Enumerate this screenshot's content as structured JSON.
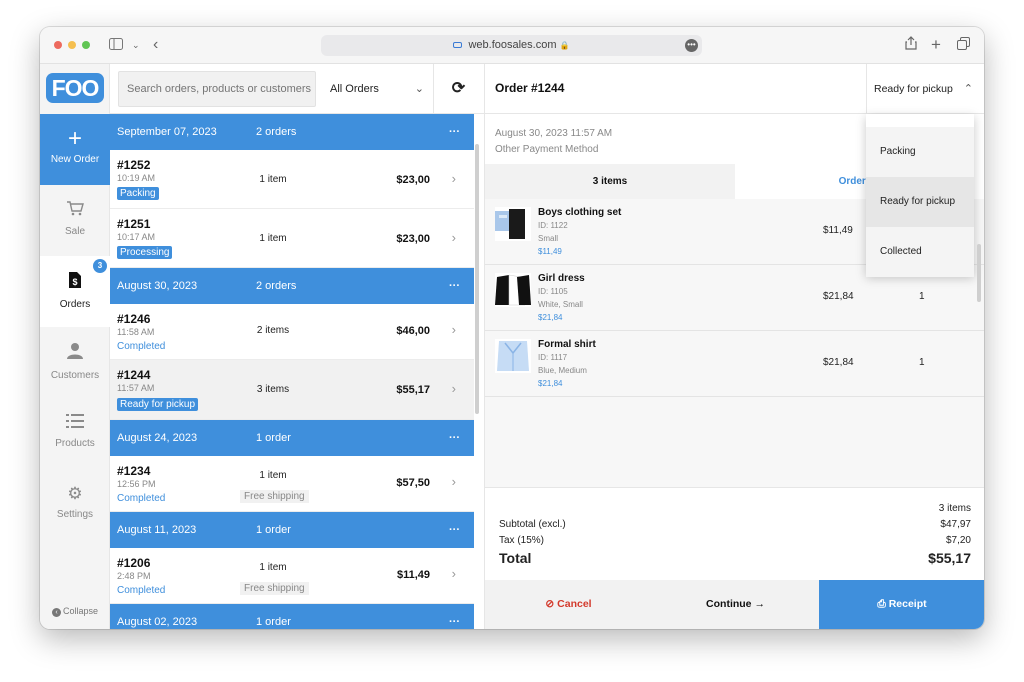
{
  "browser": {
    "url": "web.foosales.com",
    "toolbar_icons": [
      "sidebar-icon",
      "chevron-down-icon",
      "back-icon",
      "share-icon",
      "plus-icon",
      "tabs-icon"
    ]
  },
  "app": {
    "logo": "FOO",
    "accent": "#3f8fdc"
  },
  "nav": {
    "new_order": "New Order",
    "sale": "Sale",
    "orders": "Orders",
    "orders_badge": "3",
    "customers": "Customers",
    "products": "Products",
    "settings": "Settings",
    "collapse": "Collapse"
  },
  "toolbar": {
    "search_placeholder": "Search orders, products or customers",
    "filter": "All Orders"
  },
  "groups": [
    {
      "date": "September 07, 2023",
      "count": "2 orders",
      "more": "···"
    },
    {
      "date": "August 30, 2023",
      "count": "2 orders",
      "more": "···"
    },
    {
      "date": "August 24, 2023",
      "count": "1 order",
      "more": "···"
    },
    {
      "date": "August 11, 2023",
      "count": "1 order",
      "more": "···"
    },
    {
      "date": "August 02, 2023",
      "count": "1 order",
      "more": "···"
    }
  ],
  "orders": [
    {
      "number": "#1252",
      "time": "10:19 AM",
      "status": "Packing",
      "items": "1 item",
      "amount": "$23,00"
    },
    {
      "number": "#1251",
      "time": "10:17 AM",
      "status": "Processing",
      "items": "1 item",
      "amount": "$23,00"
    },
    {
      "number": "#1246",
      "time": "11:58 AM",
      "status": "Completed",
      "items": "2 items",
      "amount": "$46,00"
    },
    {
      "number": "#1244",
      "time": "11:57 AM",
      "status": "Ready for pickup",
      "items": "3 items",
      "amount": "$55,17"
    },
    {
      "number": "#1234",
      "time": "12:56 PM",
      "status": "Completed",
      "items": "1 item",
      "shipping": "Free shipping",
      "amount": "$57,50"
    },
    {
      "number": "#1206",
      "time": "2:48 PM",
      "status": "Completed",
      "items": "1 item",
      "shipping": "Free shipping",
      "amount": "$11,49"
    }
  ],
  "detail": {
    "title": "Order #1244",
    "status": "Ready for pickup",
    "date": "August 30, 2023 11:57 AM",
    "payment": "Other Payment Method",
    "tab_items": "3 items",
    "tab_details": "Order De",
    "products": [
      {
        "name": "Boys clothing set",
        "id": "ID: 1122",
        "variant": "Small",
        "price": "$11,49",
        "total": "$11,49",
        "qty": ""
      },
      {
        "name": "Girl dress",
        "id": "ID: 1105",
        "variant": "White, Small",
        "price": "$21,84",
        "total": "$21,84",
        "qty": "1"
      },
      {
        "name": "Formal shirt",
        "id": "ID: 1117",
        "variant": "Blue, Medium",
        "price": "$21,84",
        "total": "$21,84",
        "qty": "1"
      }
    ],
    "totals": {
      "count": "3 items",
      "subtotal_label": "Subtotal (excl.)",
      "subtotal": "$47,97",
      "tax_label": "Tax (15%)",
      "tax": "$7,20",
      "total_label": "Total",
      "total": "$55,17"
    },
    "actions": {
      "cancel": "Cancel",
      "continue": "Continue →",
      "receipt": "Receipt"
    },
    "dropdown": [
      "Packing",
      "Ready for pickup",
      "Collected"
    ]
  }
}
